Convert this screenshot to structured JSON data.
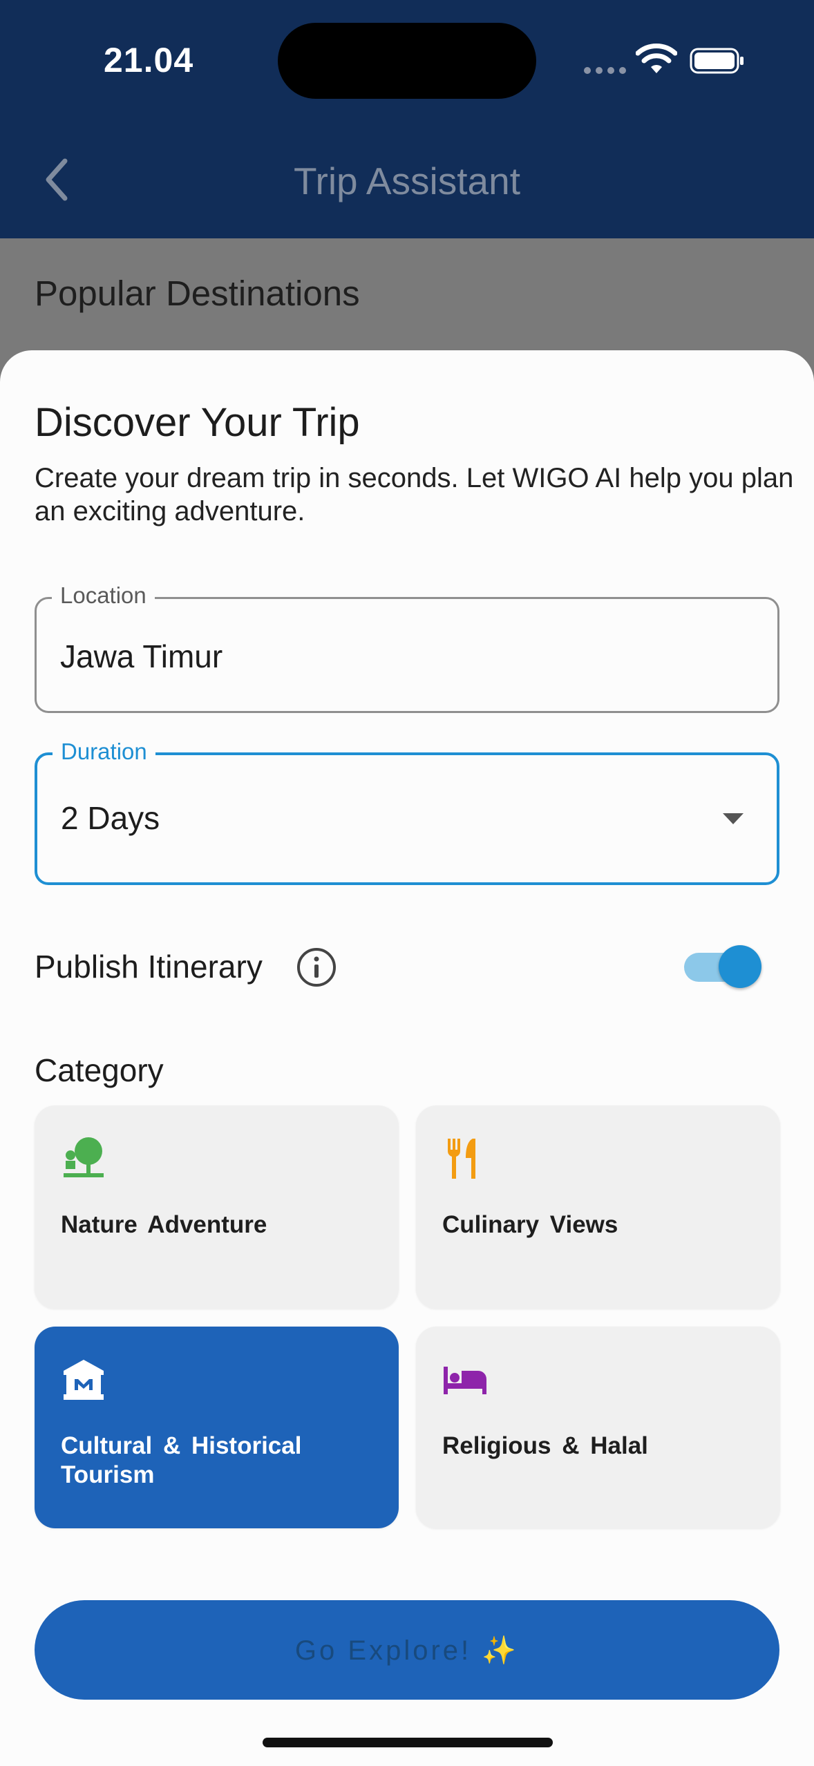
{
  "status_bar": {
    "time": "21.04"
  },
  "header": {
    "title": "Trip Assistant"
  },
  "background": {
    "section_title": "Popular Destinations"
  },
  "sheet": {
    "title": "Discover Your Trip",
    "description": "Create your dream trip in seconds. Let WIGO AI help you plan an exciting adventure.",
    "location": {
      "label": "Location",
      "value": "Jawa Timur"
    },
    "duration": {
      "label": "Duration",
      "value": "2 Days"
    },
    "publish": {
      "label": "Publish Itinerary",
      "enabled": true
    },
    "category": {
      "label": "Category",
      "items": [
        {
          "label": "Nature  Adventure",
          "icon": "park-icon",
          "color": "#4caf50",
          "selected": false
        },
        {
          "label": "Culinary  Views",
          "icon": "restaurant-icon",
          "color": "#f39c12",
          "selected": false
        },
        {
          "label": "Cultural  &  Historical Tourism",
          "icon": "museum-icon",
          "color": "#ffffff",
          "selected": true
        },
        {
          "label": "Religious  &  Halal",
          "icon": "bed-icon",
          "color": "#8e24aa",
          "selected": false
        }
      ]
    },
    "cta": {
      "label": "Go Explore! ✨"
    }
  },
  "colors": {
    "primary": "#1e63b8",
    "accent": "#1e8fd3",
    "header": "#112d58"
  }
}
